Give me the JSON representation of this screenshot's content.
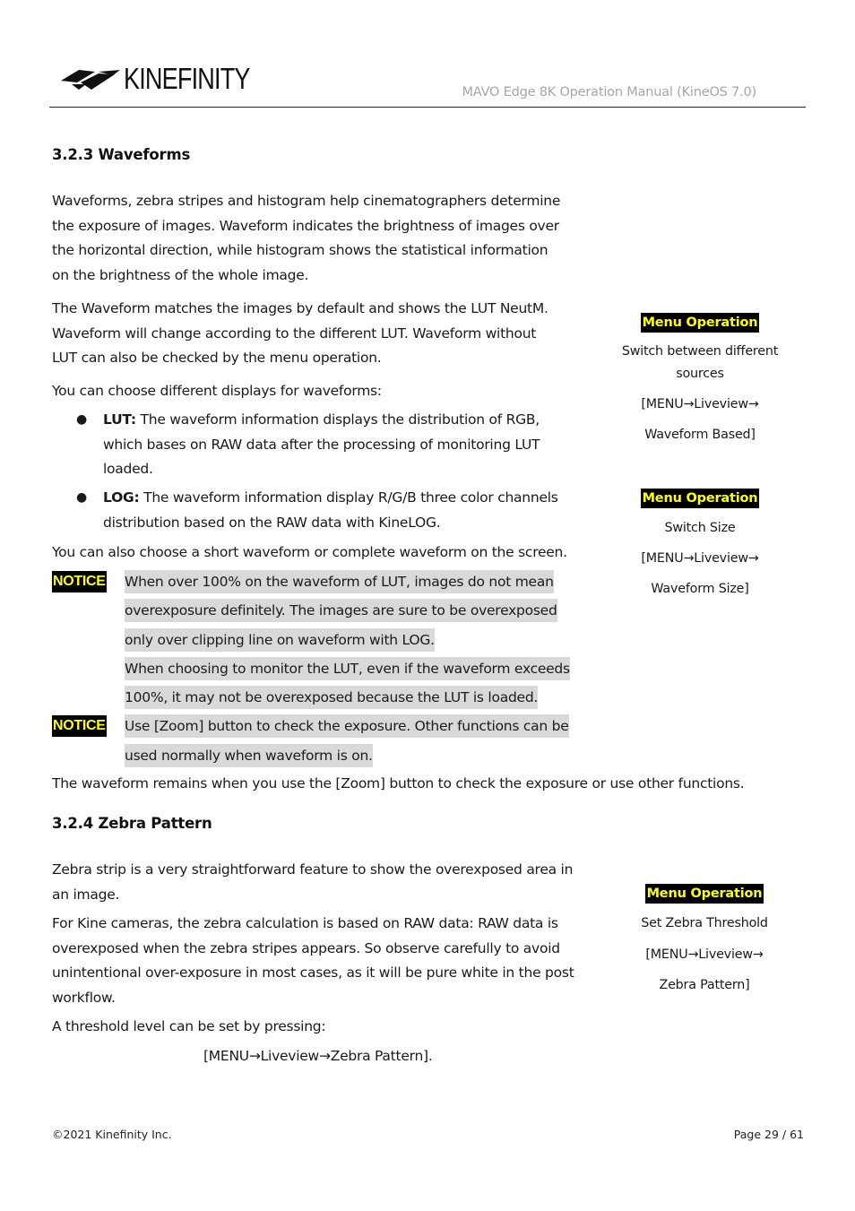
{
  "header": {
    "logo_text": "KINEFINITY",
    "doc_title": "MAVO Edge 8K Operation Manual (KineOS 7.0)"
  },
  "section_waveforms": {
    "heading": "3.2.3 Waveforms",
    "para1_lines": [
      "Waveforms, zebra stripes and histogram help cinematographers determine",
      "the exposure of images. Waveform indicates the brightness of images over",
      "the horizontal direction, while histogram shows the statistical information",
      "on the brightness of the whole image."
    ],
    "para2_lines": [
      "The Waveform matches the images by default and shows the LUT NeutM.",
      "Waveform will change according to the different LUT. Waveform without",
      "LUT can also be checked by the menu operation."
    ],
    "para3": "You can choose different displays for waveforms:",
    "bullets": [
      {
        "label": "LUT:",
        "lines": [
          " The waveform information displays the distribution of RGB,",
          "which bases on RAW data after the processing of monitoring LUT",
          "loaded."
        ]
      },
      {
        "label": "LOG:",
        "lines": [
          " The waveform information display R/G/B three color channels",
          "distribution based on the RAW data with KineLOG."
        ]
      }
    ],
    "para4": "You can also choose a short waveform or complete waveform on the screen.",
    "notices": [
      {
        "badge": "NOTICE",
        "lines": [
          "When over 100% on the waveform of LUT, images do not mean",
          "overexposure definitely. The images are sure to be overexposed",
          "only over clipping line on waveform with LOG.",
          "When choosing to monitor the LUT, even if the waveform exceeds",
          "100%, it may not be overexposed because the LUT is loaded."
        ]
      },
      {
        "badge": "NOTICE",
        "lines": [
          "Use [Zoom] button to check the exposure. Other functions can be",
          "used normally when waveform is on."
        ]
      }
    ],
    "para5": "The waveform remains when you use the [Zoom] button to check the exposure or use other functions."
  },
  "section_zebra": {
    "heading": "3.2.4 Zebra Pattern",
    "para1_lines": [
      "Zebra strip is a very straightforward feature to show the overexposed area in",
      "an image."
    ],
    "para2_lines": [
      "For Kine cameras, the zebra calculation is based on RAW data: RAW data is",
      "overexposed when the zebra stripes appears. So observe carefully to avoid",
      "unintentional over-exposure in most cases, as it will be pure white in the post",
      "workflow."
    ],
    "para3": "A threshold level can be set by pressing:",
    "menu_path": "[MENU→Liveview→Zebra Pattern]."
  },
  "sidebar": [
    {
      "badge": "Menu Operation",
      "lines": [
        "Switch between different",
        "sources",
        "[MENU→Liveview→",
        "Waveform Based]"
      ]
    },
    {
      "badge": "Menu Operation",
      "lines": [
        "Switch Size",
        "[MENU→Liveview→",
        "Waveform Size]"
      ]
    },
    {
      "badge": "Menu Operation",
      "lines": [
        "Set Zebra Threshold",
        "[MENU→Liveview→",
        "Zebra Pattern]"
      ]
    }
  ],
  "footer": {
    "copyright": "©2021 Kinefinity Inc.",
    "page": "Page 29 / 61"
  },
  "colors": {
    "badge_bg": "#000000",
    "badge_text": "#ffff00",
    "notice_highlight": "#d9d9d9",
    "header_title": "#a6a6a6"
  }
}
